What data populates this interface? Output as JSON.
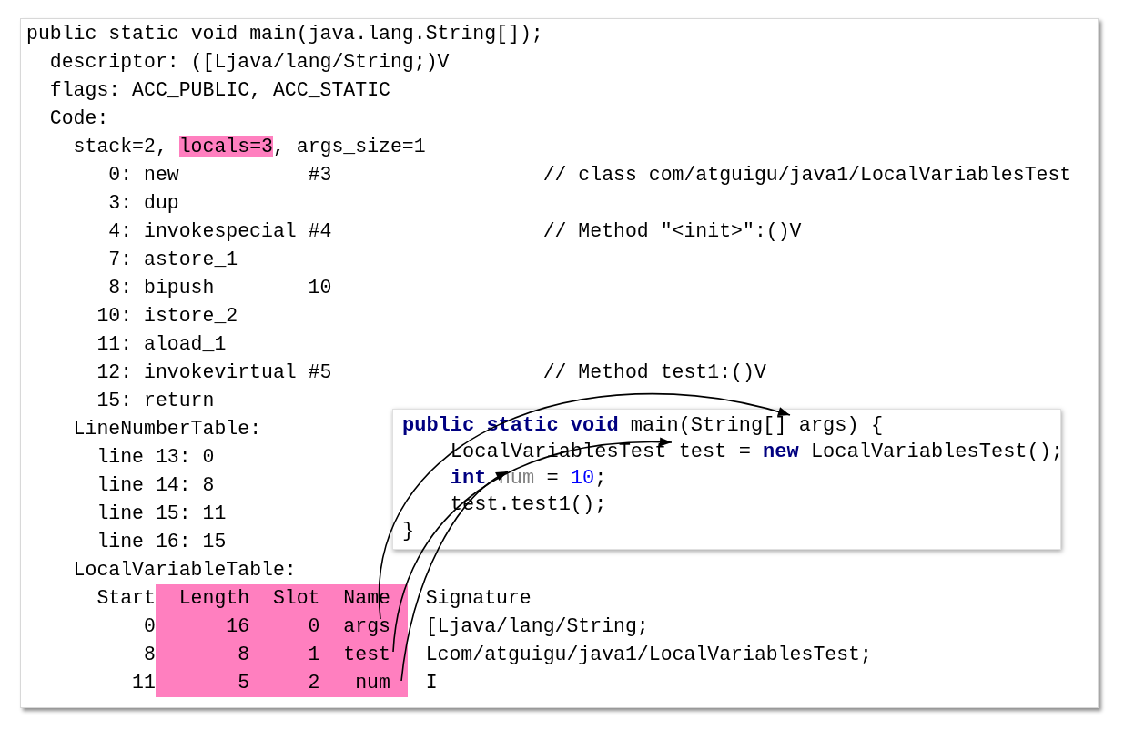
{
  "listing": {
    "header": "public static void main(java.lang.String[]);",
    "descriptor": "descriptor: ([Ljava/lang/String;)V",
    "flags": "flags: ACC_PUBLIC, ACC_STATIC",
    "code": {
      "label": "Code:",
      "stack_line": [
        {
          "text": "stack=2, ",
          "highlight": false
        },
        {
          "text": "locals=3",
          "highlight": true
        },
        {
          "text": ", args_size=1",
          "highlight": false
        }
      ],
      "instructions": [
        {
          "offset": "0:",
          "opcode": "new",
          "operand": "#3",
          "comment": "// class com/atguigu/java1/LocalVariablesTest"
        },
        {
          "offset": "3:",
          "opcode": "dup"
        },
        {
          "offset": "4:",
          "opcode": "invokespecial",
          "operand": "#4",
          "comment": "// Method \"<init>\":()V"
        },
        {
          "offset": "7:",
          "opcode": "astore_1"
        },
        {
          "offset": "8:",
          "opcode": "bipush",
          "operand": "10"
        },
        {
          "offset": "10:",
          "opcode": "istore_2"
        },
        {
          "offset": "11:",
          "opcode": "aload_1"
        },
        {
          "offset": "12:",
          "opcode": "invokevirtual",
          "operand": "#5",
          "comment": "// Method test1:()V"
        },
        {
          "offset": "15:",
          "opcode": "return"
        }
      ],
      "line_number_table": {
        "label": "LineNumberTable:",
        "lines": [
          "line 13: 0",
          "line 14: 8",
          "line 15: 11",
          "line 16: 15"
        ]
      },
      "local_variable_table": {
        "label": "LocalVariableTable:",
        "columns": [
          {
            "title": "Start",
            "highlight": false
          },
          {
            "title": "Length",
            "highlight": true
          },
          {
            "title": "Slot",
            "highlight": true
          },
          {
            "title": "Name",
            "highlight": true
          },
          {
            "title": "Signature",
            "highlight": false
          }
        ],
        "rows": [
          [
            "0",
            "16",
            "0",
            "args",
            "[Ljava/lang/String;"
          ],
          [
            "8",
            "8",
            "1",
            "test",
            "Lcom/atguigu/java1/LocalVariablesTest;"
          ],
          [
            "11",
            "5",
            "2",
            "num",
            "I"
          ]
        ]
      }
    }
  },
  "source_popup": {
    "lines": [
      [
        {
          "text": "public",
          "kind": "keyword"
        },
        {
          "text": " static",
          "kind": "keyword"
        },
        {
          "text": " void",
          "kind": "keyword"
        },
        {
          "text": " main(String[] args) {",
          "kind": "plain"
        }
      ],
      [
        {
          "text": "    LocalVariablesTest test = ",
          "kind": "plain"
        },
        {
          "text": "new",
          "kind": "keyword"
        },
        {
          "text": " LocalVariablesTest();",
          "kind": "plain"
        }
      ],
      [
        {
          "text": "    int",
          "kind": "keyword"
        },
        {
          "text": " num",
          "kind": "variable"
        },
        {
          "text": " = ",
          "kind": "plain"
        },
        {
          "text": "10",
          "kind": "number"
        },
        {
          "text": ";",
          "kind": "plain"
        }
      ],
      [
        {
          "text": "    test.test1();",
          "kind": "plain"
        }
      ],
      [
        {
          "text": "}",
          "kind": "plain"
        }
      ]
    ]
  }
}
